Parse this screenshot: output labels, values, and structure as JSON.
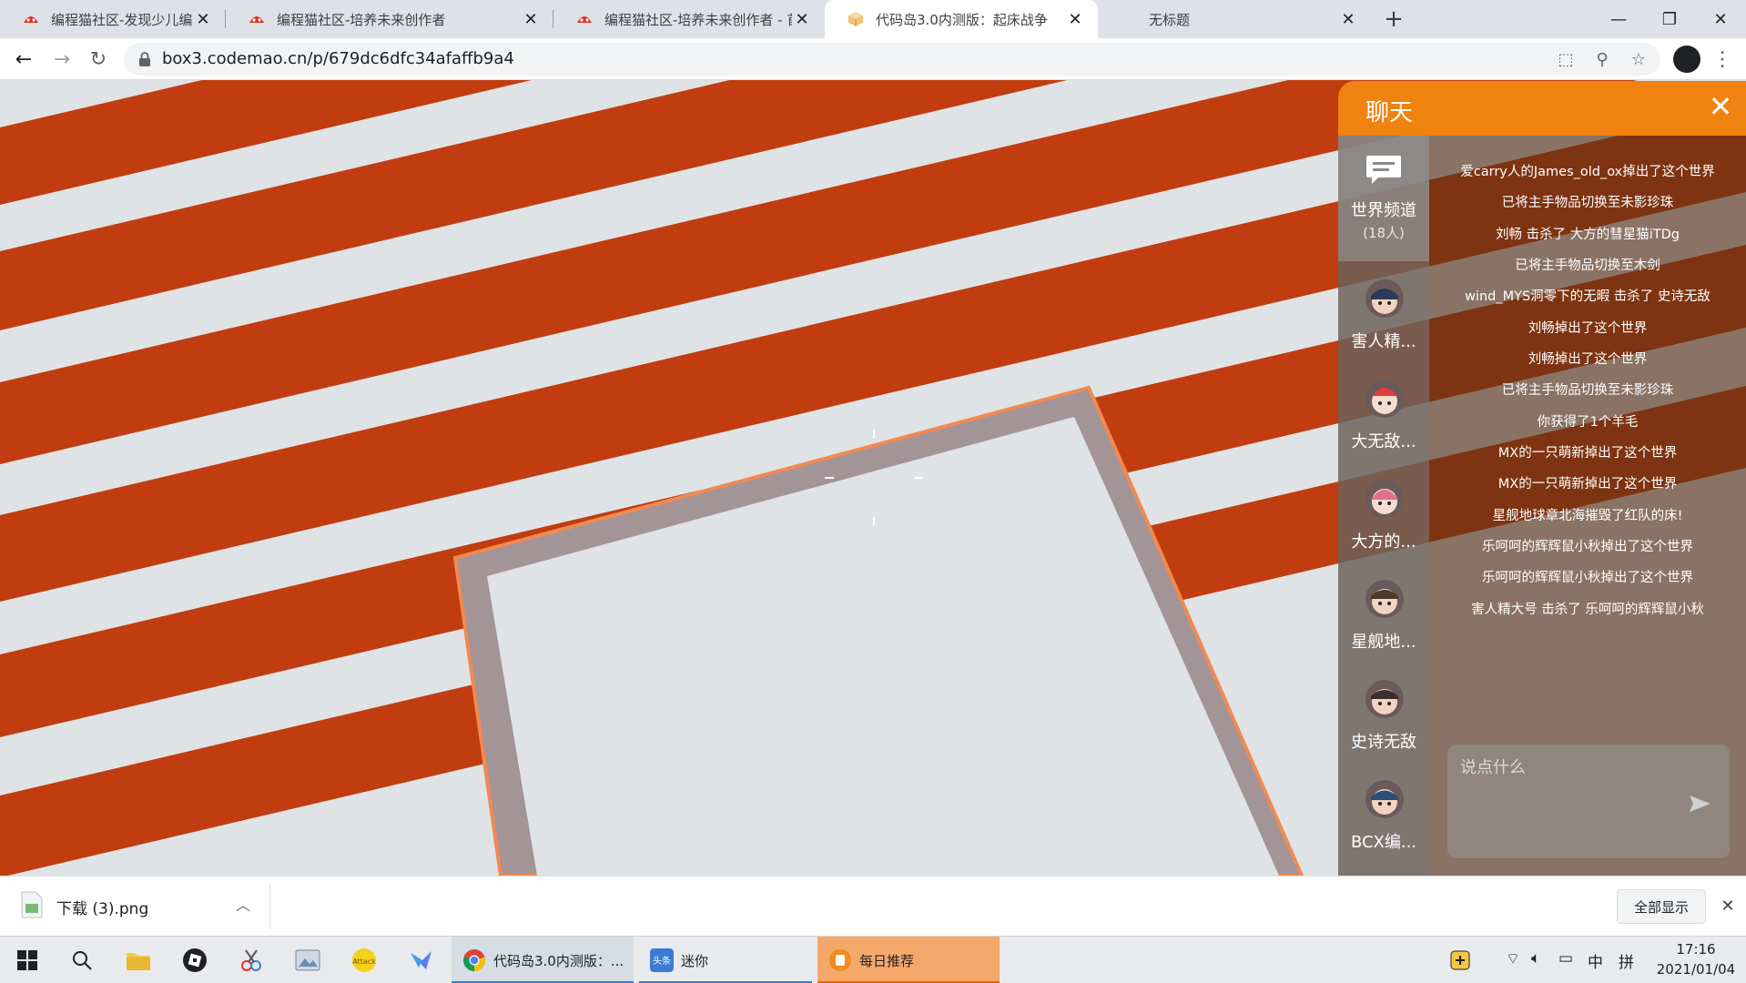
{
  "browser": {
    "tabs": [
      {
        "title": "编程猫社区-发现少儿编程作品",
        "active": false
      },
      {
        "title": "编程猫社区-培养未来创作者",
        "active": false
      },
      {
        "title": "编程猫社区-培养未来创作者 - 首",
        "active": false
      },
      {
        "title": "代码岛3.0内测版：起床战争",
        "active": true
      },
      {
        "title": "无标题",
        "active": false
      }
    ],
    "url": "box3.codemao.cn/p/679dc6dfc34afaffb9a4"
  },
  "chat": {
    "title": "聊天",
    "world_channel": {
      "name": "世界频道",
      "count": "(18人)"
    },
    "users": [
      {
        "name": "害人精..."
      },
      {
        "name": "大无敌..."
      },
      {
        "name": "大方的..."
      },
      {
        "name": "星舰地..."
      },
      {
        "name": "史诗无敌"
      },
      {
        "name": "BCX编..."
      }
    ],
    "messages": [
      "爱carry人的James_old_ox掉出了这个世界",
      "已将主手物品切换至未影珍珠",
      "刘畅 击杀了 大方的彗星猫iTDg",
      "已将主手物品切换至木剑",
      "wind_MYS洞零下的无暇 击杀了 史诗无敌",
      "刘畅掉出了这个世界",
      "刘畅掉出了这个世界",
      "已将主手物品切换至未影珍珠",
      "你获得了1个羊毛",
      "MX的一只萌新掉出了这个世界",
      "MX的一只萌新掉出了这个世界",
      "星舰地球章北海摧毁了红队的床!",
      "乐呵呵的辉辉鼠小秋掉出了这个世界",
      "乐呵呵的辉辉鼠小秋掉出了这个世界",
      "害人精大号 击杀了 乐呵呵的辉辉鼠小秋"
    ],
    "input_placeholder": "说点什么"
  },
  "download_bar": {
    "file_name": "下载 (3).png",
    "show_all": "全部显示"
  },
  "taskbar": {
    "apps": [
      {
        "label": "代码岛3.0内测版：..."
      },
      {
        "label": "迷你"
      },
      {
        "label": "每日推荐"
      }
    ],
    "tray_ime": "中",
    "tray_mode": "拼",
    "time": "17:16",
    "date": "2021/01/04"
  },
  "colors": {
    "accent": "#f0820f",
    "stripe_orange": "#c13d10",
    "stripe_light": "#dfe3e6",
    "platform_border": "#a39498"
  }
}
